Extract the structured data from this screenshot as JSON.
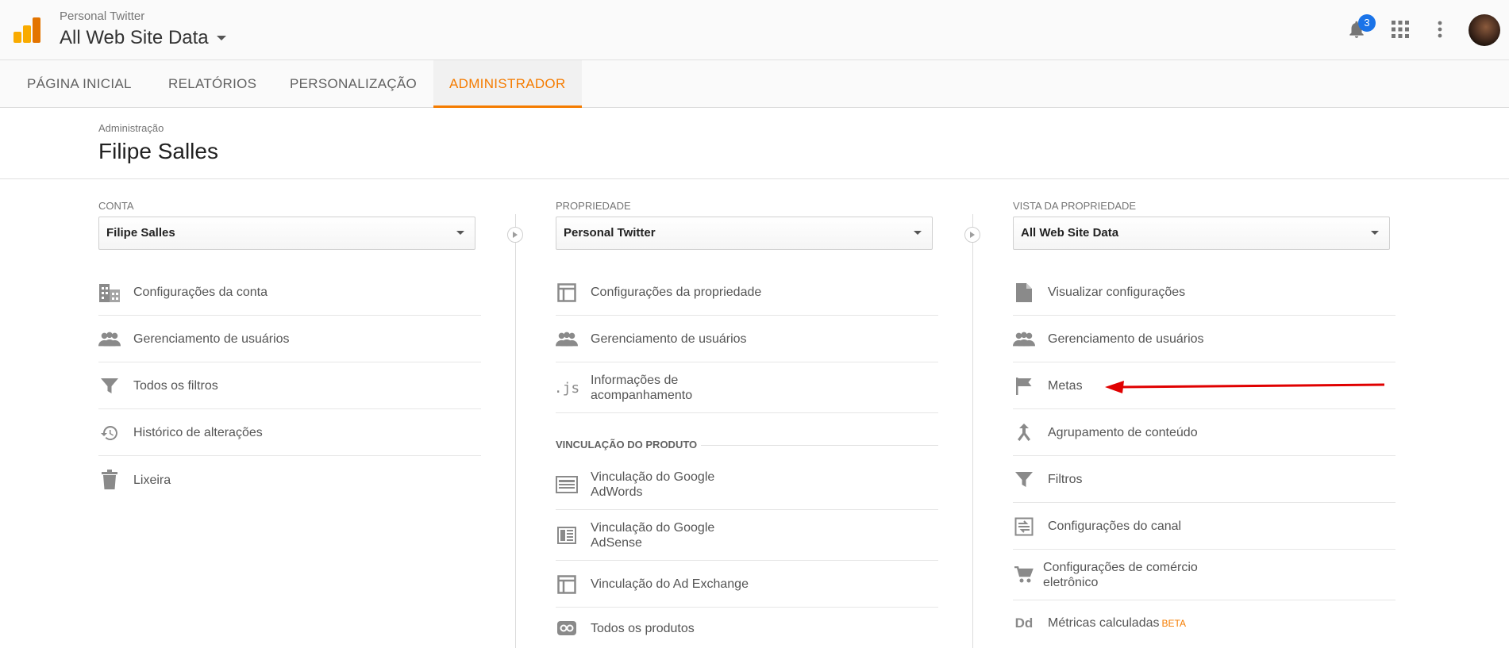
{
  "header": {
    "account_small": "Personal Twitter",
    "account_big": "All Web Site Data",
    "notification_count": "3"
  },
  "tabs": [
    {
      "label": "PÁGINA INICIAL"
    },
    {
      "label": "RELATÓRIOS"
    },
    {
      "label": "PERSONALIZAÇÃO"
    },
    {
      "label": "ADMINISTRADOR",
      "active": true
    }
  ],
  "breadcrumb": "Administração",
  "page_title": "Filipe Salles",
  "colors": {
    "accent": "#f57c00",
    "badge": "#1a73e8",
    "annotation_arrow": "#e00000"
  },
  "columns": {
    "account": {
      "label": "CONTA",
      "selected": "Filipe Salles",
      "items": [
        {
          "label": "Configurações da conta",
          "icon": "building-icon"
        },
        {
          "label": "Gerenciamento de usuários",
          "icon": "users-icon"
        },
        {
          "label": "Todos os filtros",
          "icon": "filter-icon"
        },
        {
          "label": "Histórico de alterações",
          "icon": "history-icon"
        },
        {
          "label": "Lixeira",
          "icon": "trash-icon"
        }
      ]
    },
    "property": {
      "label": "PROPRIEDADE",
      "selected": "Personal Twitter",
      "items": [
        {
          "label": "Configurações da propriedade",
          "icon": "layout-icon"
        },
        {
          "label": "Gerenciamento de usuários",
          "icon": "users-icon"
        },
        {
          "label_line1": "Informações de",
          "label_line2": "acompanhamento",
          "icon": "js-icon",
          "icon_text": ".js"
        }
      ],
      "section": "VINCULAÇÃO DO PRODUTO",
      "product_items": [
        {
          "label_line1": "Vinculação do Google",
          "label_line2": "AdWords",
          "icon": "adwords-icon"
        },
        {
          "label_line1": "Vinculação do Google",
          "label_line2": "AdSense",
          "icon": "adsense-icon"
        },
        {
          "label": "Vinculação do Ad Exchange",
          "icon": "adexchange-icon"
        },
        {
          "label": "Todos os produtos",
          "icon": "link-icon"
        }
      ]
    },
    "view": {
      "label": "VISTA DA PROPRIEDADE",
      "selected": "All Web Site Data",
      "items": [
        {
          "label": "Visualizar configurações",
          "icon": "document-icon"
        },
        {
          "label": "Gerenciamento de usuários",
          "icon": "users-icon"
        },
        {
          "label": "Metas",
          "icon": "flag-icon"
        },
        {
          "label": "Agrupamento de conteúdo",
          "icon": "merge-icon"
        },
        {
          "label": "Filtros",
          "icon": "filter-icon"
        },
        {
          "label": "Configurações do canal",
          "icon": "channel-icon"
        },
        {
          "label_line1": "Configurações de comércio",
          "label_line2": "eletrônico",
          "icon": "cart-icon"
        },
        {
          "label": "Métricas calculadas",
          "beta": "BETA",
          "icon": "dd-icon",
          "icon_text": "Dd"
        }
      ]
    }
  }
}
